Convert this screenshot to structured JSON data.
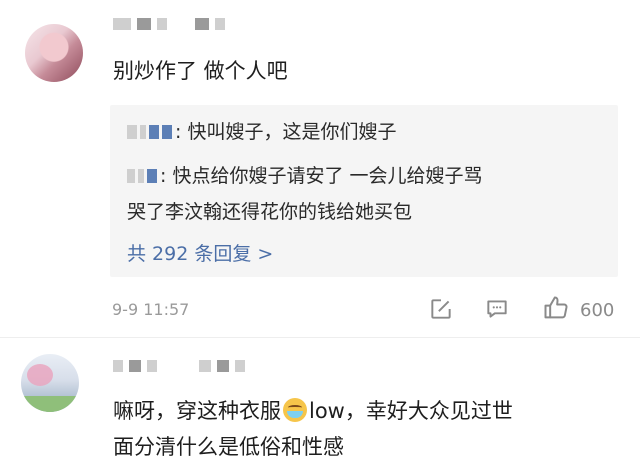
{
  "comment1": {
    "text": "别炒作了  做个人吧",
    "replies": [
      {
        "text": ": 快叫嫂子，这是你们嫂子"
      },
      {
        "text_line1": ": 快点给你嫂子请安了 一会儿给嫂子骂",
        "text_line2": "哭了李汶翰还得花你的钱给她买包"
      }
    ],
    "more_replies": "共 292 条回复 >",
    "time": "9-9 11:57",
    "like_count": "600"
  },
  "comment2": {
    "text_line1_a": "嘛呀，穿这种衣服",
    "emoji": "face-with-tears-emoji",
    "text_line1_b": "low，幸好大众见过世",
    "text_line2": "面分清什么是低俗和性感"
  }
}
